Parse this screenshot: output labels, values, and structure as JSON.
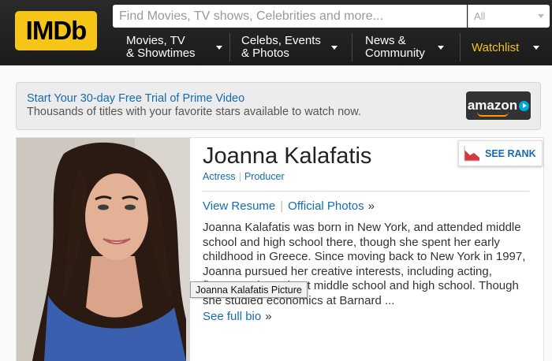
{
  "header": {
    "logo_text": "IMDb",
    "search_placeholder": "Find Movies, TV shows, Celebrities and more...",
    "search_category": "All",
    "nav": [
      {
        "line1": "Movies, TV",
        "line2": "& Showtimes"
      },
      {
        "line1": "Celebs, Events",
        "line2": "& Photos"
      },
      {
        "line1": "News &",
        "line2": "Community"
      }
    ],
    "watchlist_label": "Watchlist"
  },
  "promo": {
    "headline": "Start Your 30-day Free Trial of Prime Video",
    "subline": "Thousands of titles with your favorite stars available to watch now.",
    "brand_label": "amazon"
  },
  "profile": {
    "name": "Joanna Kalafatis",
    "roles": [
      "Actress",
      "Producer"
    ],
    "see_rank_label": "SEE RANK",
    "links": [
      "View Resume",
      "Official Photos"
    ],
    "bio": "Joanna Kalafatis was born in New York, and attended middle school and high school there, though she spent her early childhood in Greece. Since moving back to New York in 1997, Joanna pursued her creative interests, including acting, flamenco throughout middle school and high school. Though she studied economics at Barnard ...",
    "see_full_bio": "See full bio",
    "photo_tooltip": "Joanna Kalafatis Picture"
  },
  "colors": {
    "brand_yellow": "#f5c518",
    "link_blue": "#136cb2",
    "header_bg": "#1f1f1f"
  },
  "icons": [
    "caret-down-icon",
    "rank-chart-icon",
    "amazon-logo",
    "raquo-icon"
  ]
}
